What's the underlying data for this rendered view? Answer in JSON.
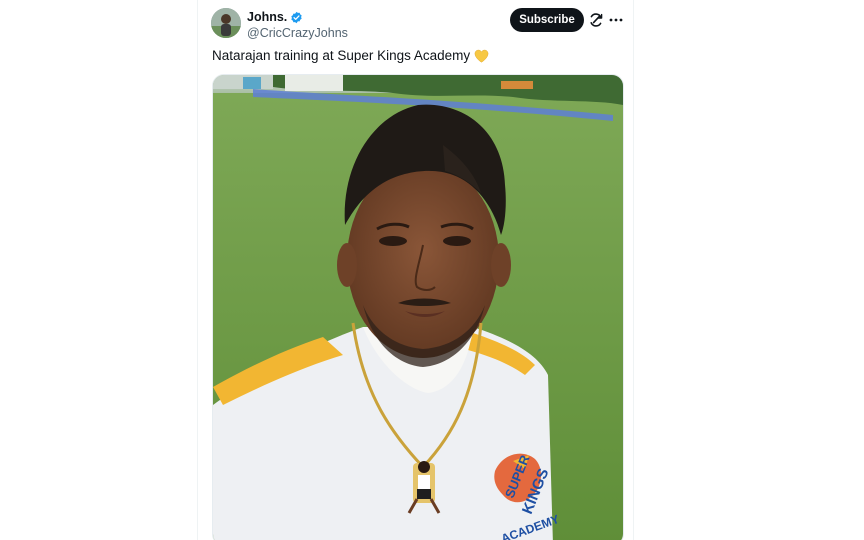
{
  "tweet": {
    "author": {
      "display_name": "Johns.",
      "handle": "@CricCrazyJohns",
      "verified": true
    },
    "actions": {
      "subscribe_label": "Subscribe"
    },
    "text": "Natarajan training at Super Kings Academy",
    "emoji": "yellow-heart-icon",
    "media": {
      "jersey_lines": [
        "SUPER",
        "KINGS",
        "ACADEMY"
      ]
    }
  },
  "colors": {
    "button_bg": "#0f1419",
    "verified_blue": "#1d9bf0",
    "heart_yellow": "#f7c844",
    "handle_gray": "#536471"
  }
}
